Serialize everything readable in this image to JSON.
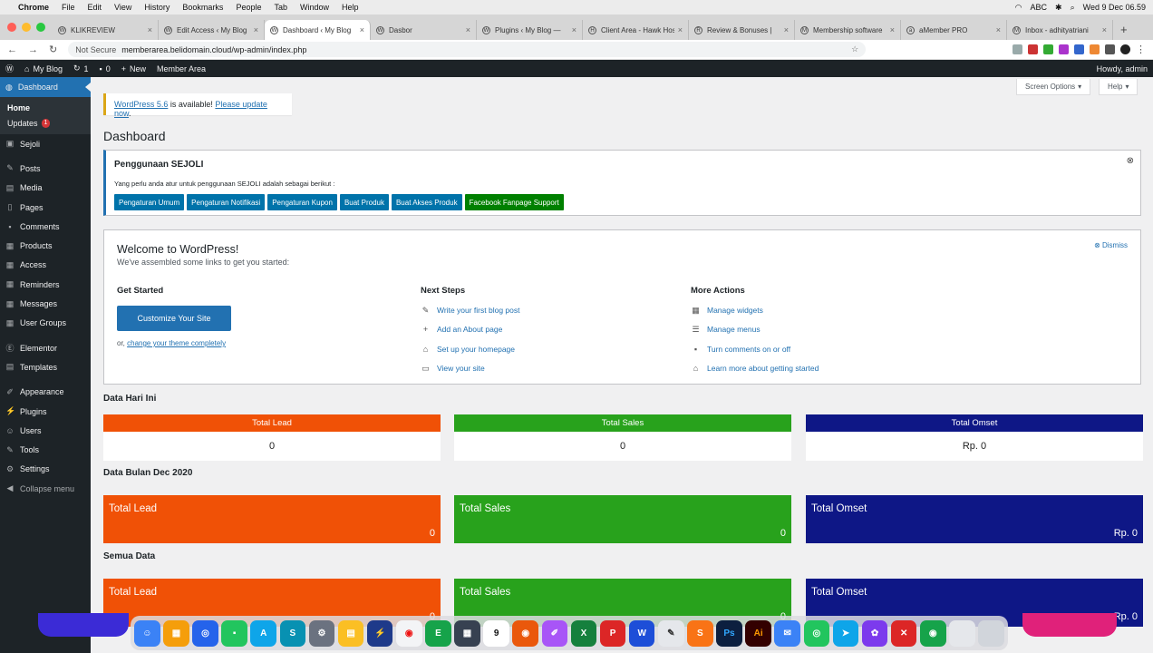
{
  "mac_menu": {
    "app": "Chrome",
    "items": [
      "File",
      "Edit",
      "View",
      "History",
      "Bookmarks",
      "People",
      "Tab",
      "Window",
      "Help"
    ],
    "clock": "Wed 9 Dec  06.59",
    "abc": "ABC"
  },
  "tabs": [
    {
      "title": "KLIKREVIEW",
      "active": false
    },
    {
      "title": "Edit Access ‹ My Blog",
      "active": false
    },
    {
      "title": "Dashboard ‹ My Blog",
      "active": true
    },
    {
      "title": "Dasbor",
      "active": false
    },
    {
      "title": "Plugins ‹ My Blog — ",
      "active": false
    },
    {
      "title": "Client Area - Hawk Host",
      "active": false
    },
    {
      "title": "Review & Bonuses | ",
      "active": false
    },
    {
      "title": "Membership software",
      "active": false
    },
    {
      "title": "aMember PRO",
      "active": false
    },
    {
      "title": "Inbox - adhityatriani",
      "active": false
    }
  ],
  "address": {
    "not_secure": "Not Secure",
    "url": "memberarea.belidomain.cloud/wp-admin/index.php"
  },
  "adminbar": {
    "site": "My Blog",
    "updates": "1",
    "comments": "0",
    "new": "New",
    "member_area": "Member Area",
    "howdy": "Howdy, admin"
  },
  "sidebar": {
    "dashboard": "Dashboard",
    "home": "Home",
    "updates": "Updates",
    "updates_count": "1",
    "items": [
      "Sejoli",
      "Posts",
      "Media",
      "Pages",
      "Comments",
      "Products",
      "Access",
      "Reminders",
      "Messages",
      "User Groups",
      "Elementor",
      "Templates",
      "Appearance",
      "Plugins",
      "Users",
      "Tools",
      "Settings",
      "Collapse menu"
    ]
  },
  "notice": {
    "link1": "WordPress 5.6",
    "middle": " is available! ",
    "link2": "Please update now",
    "end": "."
  },
  "screen_options": "Screen Options",
  "help": "Help",
  "page_title": "Dashboard",
  "sejoli": {
    "title": "Penggunaan SEJOLI",
    "desc": "Yang perlu anda atur untuk penggunaan SEJOLI adalah sebagai berikut :",
    "buttons": [
      "Pengaturan Umum",
      "Pengaturan Notifikasi",
      "Pengaturan Kupon",
      "Buat Produk",
      "Buat Akses Produk",
      "Facebook Fanpage Support"
    ]
  },
  "welcome": {
    "title": "Welcome to WordPress!",
    "subtitle": "We've assembled some links to get you started:",
    "dismiss": "Dismiss",
    "get_started": "Get Started",
    "customize": "Customize Your Site",
    "or": "or, ",
    "change_theme": "change your theme completely",
    "next_steps": "Next Steps",
    "next_links": [
      "Write your first blog post",
      "Add an About page",
      "Set up your homepage",
      "View your site"
    ],
    "more_actions": "More Actions",
    "more_links": [
      "Manage widgets",
      "Manage menus",
      "Turn comments on or off",
      "Learn more about getting started"
    ]
  },
  "stats": {
    "today_title": "Data Hari Ini",
    "today": [
      {
        "label": "Total Lead",
        "value": "0"
      },
      {
        "label": "Total Sales",
        "value": "0"
      },
      {
        "label": "Total Omset",
        "value": "Rp. 0"
      }
    ],
    "month_title": "Data Bulan Dec 2020",
    "month": [
      {
        "label": "Total Lead",
        "value": "0"
      },
      {
        "label": "Total Sales",
        "value": "0"
      },
      {
        "label": "Total Omset",
        "value": "Rp. 0"
      }
    ],
    "all_title": "Semua Data",
    "all": [
      {
        "label": "Total Lead",
        "value": "0"
      },
      {
        "label": "Total Sales",
        "value": "0"
      },
      {
        "label": "Total Omset",
        "value": "Rp. 0"
      }
    ]
  },
  "dock_calendar_day": "9",
  "colors": {
    "lead": "#f05106",
    "sales": "#28a21c",
    "omset": "#0e1786",
    "wp_blue": "#2271b1",
    "admin_dark": "#1d2327"
  }
}
